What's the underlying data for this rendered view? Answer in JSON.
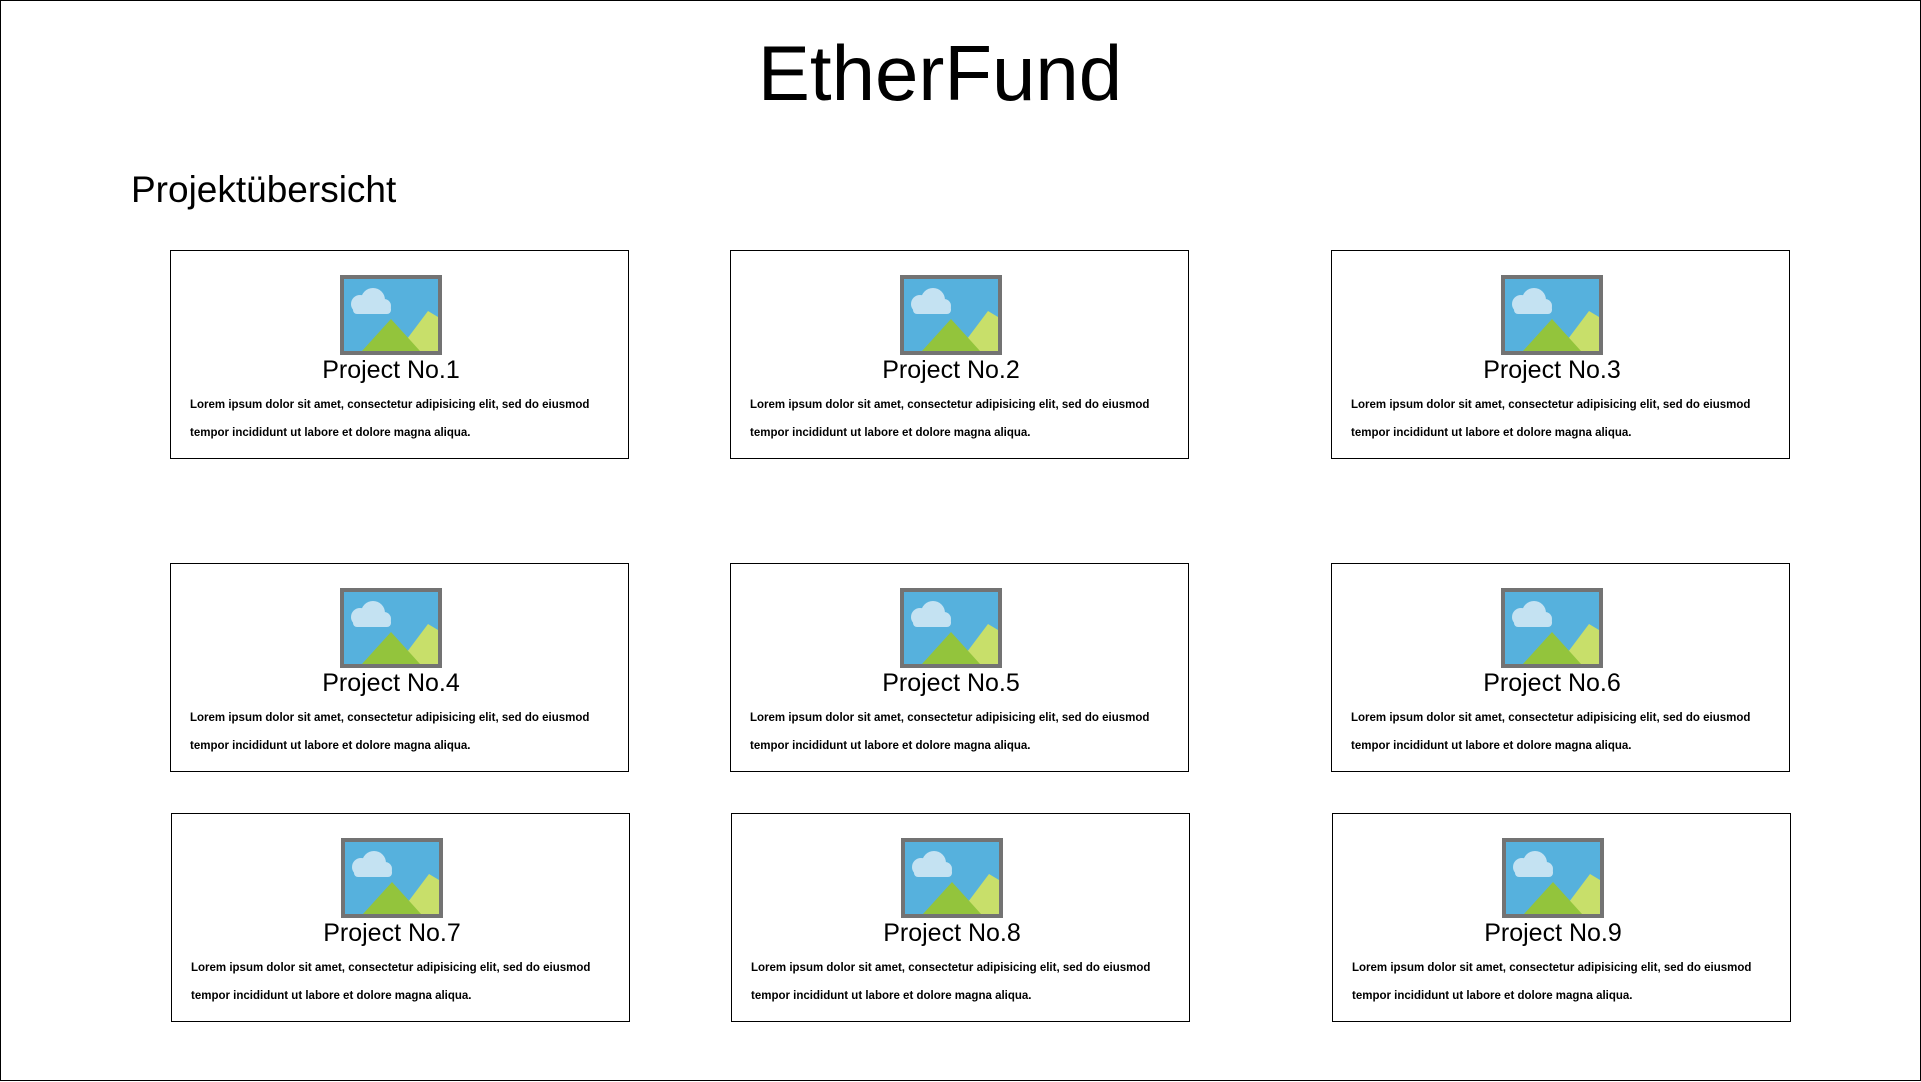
{
  "app": {
    "title": "EtherFund"
  },
  "section": {
    "title": "Projektübersicht"
  },
  "projects": [
    {
      "title": "Project No.1",
      "description": "Lorem ipsum dolor sit amet, consectetur adipisicing elit, sed do eiusmod tempor incididunt ut labore et dolore magna aliqua.",
      "image_icon": "image-placeholder-icon"
    },
    {
      "title": "Project No.2",
      "description": "Lorem ipsum dolor sit amet, consectetur adipisicing elit, sed do eiusmod tempor incididunt ut labore et dolore magna aliqua.",
      "image_icon": "image-placeholder-icon"
    },
    {
      "title": "Project No.3",
      "description": "Lorem ipsum dolor sit amet, consectetur adipisicing elit, sed do eiusmod tempor incididunt ut labore et dolore magna aliqua.",
      "image_icon": "image-placeholder-icon"
    },
    {
      "title": "Project No.4",
      "description": "Lorem ipsum dolor sit amet, consectetur adipisicing elit, sed do eiusmod tempor incididunt ut labore et dolore magna aliqua.",
      "image_icon": "image-placeholder-icon"
    },
    {
      "title": "Project No.5",
      "description": "Lorem ipsum dolor sit amet, consectetur adipisicing elit, sed do eiusmod tempor incididunt ut labore et dolore magna aliqua.",
      "image_icon": "image-placeholder-icon"
    },
    {
      "title": "Project No.6",
      "description": "Lorem ipsum dolor sit amet, consectetur adipisicing elit, sed do eiusmod tempor incididunt ut labore et dolore magna aliqua.",
      "image_icon": "image-placeholder-icon"
    },
    {
      "title": "Project No.7",
      "description": "Lorem ipsum dolor sit amet, consectetur adipisicing elit, sed do eiusmod tempor incididunt ut labore et dolore magna aliqua.",
      "image_icon": "image-placeholder-icon"
    },
    {
      "title": "Project No.8",
      "description": "Lorem ipsum dolor sit amet, consectetur adipisicing elit, sed do eiusmod tempor incididunt ut labore et dolore magna aliqua.",
      "image_icon": "image-placeholder-icon"
    },
    {
      "title": "Project No.9",
      "description": "Lorem ipsum dolor sit amet, consectetur adipisicing elit, sed do eiusmod tempor incididunt ut labore et dolore magna aliqua.",
      "image_icon": "image-placeholder-icon"
    }
  ],
  "colors": {
    "image_frame": "#737373",
    "sky": "#56b1dd",
    "cloud": "#c4e2f2",
    "mountain_dark": "#93c43c",
    "mountain_light": "#c8df6a"
  }
}
